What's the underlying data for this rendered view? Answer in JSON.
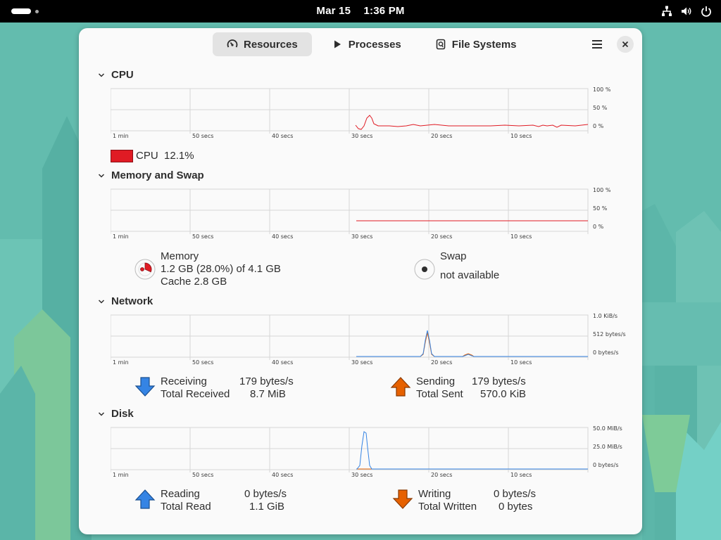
{
  "topbar": {
    "date": "Mar 15",
    "time": "1:36 PM",
    "icons": [
      "network-wired-icon",
      "volume-icon",
      "power-icon"
    ]
  },
  "window": {
    "tabs": [
      {
        "label": "Resources",
        "icon": "gauge-icon",
        "active": true
      },
      {
        "label": "Processes",
        "icon": "play-icon",
        "active": false
      },
      {
        "label": "File Systems",
        "icon": "disk-icon",
        "active": false
      }
    ]
  },
  "time_labels": [
    "1 min",
    "50 secs",
    "40 secs",
    "30 secs",
    "20 secs",
    "10 secs"
  ],
  "cpu": {
    "title": "CPU",
    "y_labels": [
      "100 %",
      "50 %",
      "0 %"
    ],
    "legend_label": "CPU",
    "legend_value": "12.1%",
    "color": "#e01b24"
  },
  "memory": {
    "title": "Memory and Swap",
    "y_labels": [
      "100 %",
      "50 %",
      "0 %"
    ],
    "memory_label": "Memory",
    "memory_used": "1.2 GB (28.0%) of 4.1 GB",
    "memory_cache": "Cache 2.8 GB",
    "memory_fraction": 0.28,
    "swap_label": "Swap",
    "swap_value": "not available",
    "color": "#e01b24"
  },
  "network": {
    "title": "Network",
    "y_labels": [
      "1.0 KiB/s",
      "512 bytes/s",
      "0 bytes/s"
    ],
    "receiving_label": "Receiving",
    "receiving_value": "179 bytes/s",
    "total_received_label": "Total Received",
    "total_received_value": "8.7 MiB",
    "sending_label": "Sending",
    "sending_value": "179 bytes/s",
    "total_sent_label": "Total Sent",
    "total_sent_value": "570.0 KiB",
    "receive_color": "#3584e4",
    "send_color": "#e66100"
  },
  "disk": {
    "title": "Disk",
    "y_labels": [
      "50.0 MiB/s",
      "25.0 MiB/s",
      "0 bytes/s"
    ],
    "reading_label": "Reading",
    "reading_value": "0 bytes/s",
    "total_read_label": "Total Read",
    "total_read_value": "1.1 GiB",
    "writing_label": "Writing",
    "writing_value": "0 bytes/s",
    "total_written_label": "Total Written",
    "total_written_value": "0 bytes",
    "read_color": "#3584e4",
    "write_color": "#e66100"
  }
}
